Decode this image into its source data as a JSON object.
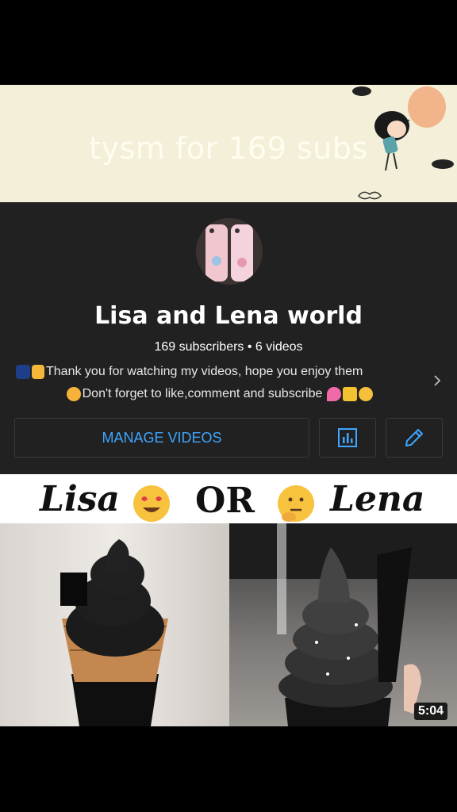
{
  "banner": {
    "text": "tysm for 169 subs"
  },
  "channel": {
    "name": "Lisa and Lena world",
    "meta": "169 subscribers • 6 videos",
    "description_line1": "Thank you for watching my videos, hope you enjoy them",
    "description_line2": "Don't forget to like,comment and subscribe"
  },
  "actions": {
    "manage_videos": "MANAGE VIDEOS"
  },
  "video": {
    "title_left": "Lisa",
    "title_or": "OR",
    "title_right": "Lena",
    "duration": "5:04"
  },
  "icons": [
    "balloon-girl-icon",
    "sparkle-emoji-icon",
    "smile-emoji-icon",
    "heart-emoji-icon",
    "lock-emoji-icon",
    "hug-emoji-icon",
    "chevron-right-icon",
    "analytics-icon",
    "edit-pencil-icon",
    "heart-eyes-emoji-icon",
    "thinking-emoji-icon"
  ],
  "colors": {
    "accent": "#3ea6ff",
    "panel": "#212121",
    "banner": "#f3efd8"
  }
}
